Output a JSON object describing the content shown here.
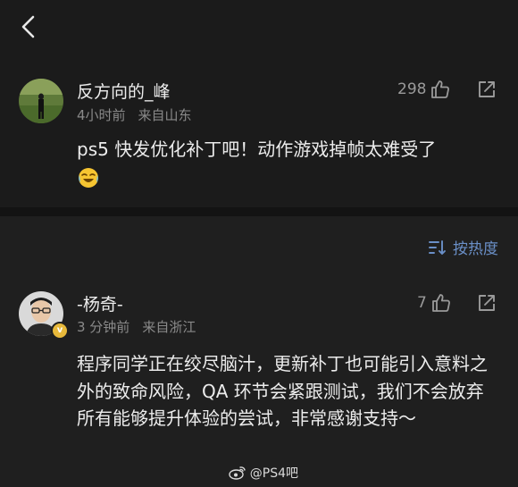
{
  "header": {
    "back_icon": "chevron-left-icon"
  },
  "post": {
    "username": "反方向的_峰",
    "time": "4小时前",
    "location": "来自山东",
    "likes": "298",
    "content": "ps5 快发优化补丁吧！动作游戏掉帧太难受了",
    "emoji": "crying-laughing-emoji"
  },
  "comments_bar": {
    "sort_label": "按热度",
    "sort_icon": "sort-icon"
  },
  "reply": {
    "username": "-杨奇-",
    "time": "3 分钟前",
    "location": "来自浙江",
    "likes": "7",
    "verified_badge": "v",
    "content": "程序同学正在绞尽脑汁，更新补丁也可能引入意料之外的致命风险，QA 环节会紧跟测试，我们不会放弃所有能够提升体验的尝试，非常感谢支持～"
  },
  "watermark": {
    "text": "@PS4吧"
  },
  "colors": {
    "background": "#1b1b1b",
    "accent": "#6a8fc7",
    "muted": "#8a8a8a",
    "badge": "#e8b93b"
  }
}
